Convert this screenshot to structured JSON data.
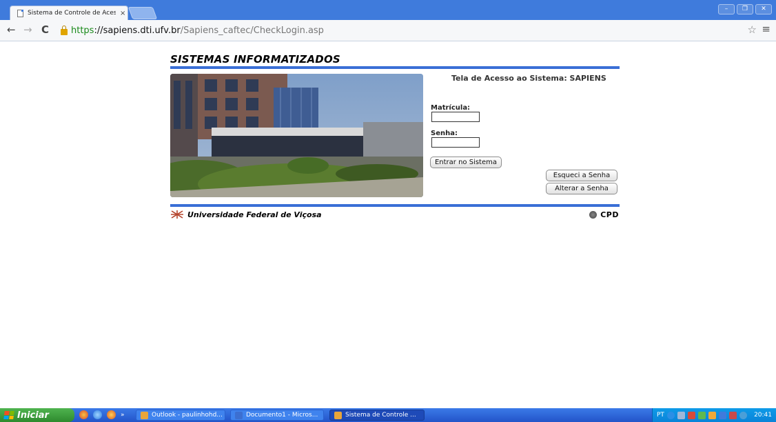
{
  "browser": {
    "tab_title": "Sistema de Controle de Aces",
    "tab_close": "×",
    "url_scheme": "https",
    "url_host": "://sapiens.dti.ufv.br",
    "url_path": "/Sapiens_caftec/CheckLogin.asp",
    "back_icon": "←",
    "forward_icon": "→",
    "reload_icon": "C",
    "star_icon": "☆",
    "menu_icon": "≡",
    "min_icon": "–",
    "max_icon": "❐",
    "close_icon": "✕"
  },
  "page": {
    "heading": "SISTEMAS INFORMATIZADOS",
    "access_title": "Tela de Acesso ao Sistema: SAPIENS",
    "matricula_label": "Matrícula:",
    "matricula_value": "",
    "senha_label": "Senha:",
    "senha_value": "",
    "login_button": "Entrar no Sistema",
    "forgot_button": "Esqueci a Senha",
    "change_button": "Alterar a Senha",
    "footer_university": "Universidade Federal de Viçosa",
    "footer_cpd": "CPD",
    "accent_color": "#3a6fd6"
  },
  "taskbar": {
    "start_label": "Iniciar",
    "more": "»",
    "tasks": [
      {
        "label": "Outlook - paulinhohd...",
        "icon_color": "#e8a53a"
      },
      {
        "label": "Documento1 - Micros...",
        "icon_color": "#3c6fd1"
      },
      {
        "label": "Sistema de Controle ...",
        "icon_color": "#e8a53a"
      }
    ],
    "lang": "PT",
    "clock": "20:41"
  }
}
